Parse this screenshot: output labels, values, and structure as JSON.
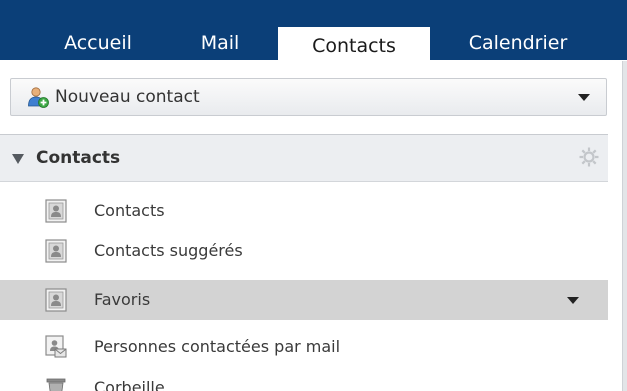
{
  "tabs": [
    {
      "label": "Accueil",
      "active": false
    },
    {
      "label": "Mail",
      "active": false
    },
    {
      "label": "Contacts",
      "active": true
    },
    {
      "label": "Calendrier",
      "active": false
    }
  ],
  "toolbar": {
    "new_contact_label": "Nouveau contact",
    "new_contact_icon": "person-add-icon",
    "dropdown_icon": "chevron-down-icon"
  },
  "panel": {
    "title": "Contacts",
    "expanded": true,
    "settings_icon": "gear-icon",
    "items": [
      {
        "label": "Contacts",
        "icon": "contact-card-icon",
        "selected": false
      },
      {
        "label": "Contacts suggérés",
        "icon": "contact-card-icon",
        "selected": false
      },
      {
        "label": "Favoris",
        "icon": "contact-card-icon",
        "selected": true
      },
      {
        "label": "Personnes contactées par mail",
        "icon": "contact-card-mail-icon",
        "selected": false
      },
      {
        "label": "Corbeille",
        "icon": "trash-icon",
        "selected": false
      }
    ]
  },
  "colors": {
    "nav_bar": "#0b3f78",
    "selected_row": "#d3d3d3",
    "panel_header": "#eceef1"
  }
}
